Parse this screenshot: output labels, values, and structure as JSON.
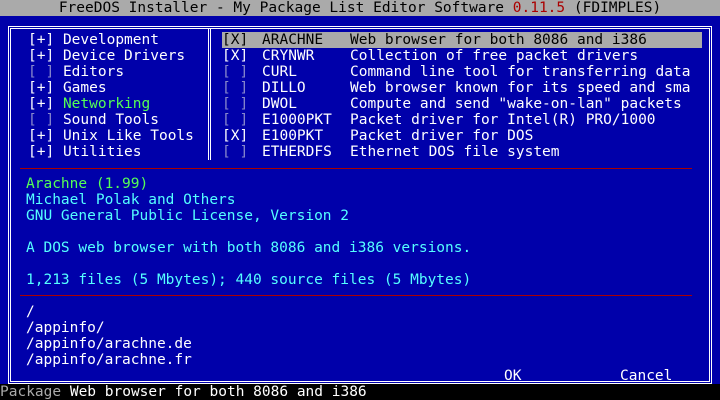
{
  "title": {
    "prefix": "FreeDOS Installer - My Package List Editor Software ",
    "version": "0.11.5",
    "suffix": " (FDIMPLES)"
  },
  "categories": [
    {
      "check": "[+]",
      "label": "Development"
    },
    {
      "check": "[+]",
      "label": "Device Drivers"
    },
    {
      "check": "[ ]",
      "label": "Editors"
    },
    {
      "check": "[+]",
      "label": "Games"
    },
    {
      "check": "[+]",
      "label": "Networking"
    },
    {
      "check": "[ ]",
      "label": "Sound Tools"
    },
    {
      "check": "[+]",
      "label": "Unix Like Tools"
    },
    {
      "check": "[+]",
      "label": "Utilities"
    }
  ],
  "selected_category": "Networking",
  "packages": [
    {
      "check": "[X]",
      "name": "ARACHNE",
      "desc": "Web browser for both 8086 and i386"
    },
    {
      "check": "[X]",
      "name": "CRYNWR",
      "desc": "Collection of free packet drivers"
    },
    {
      "check": "[ ]",
      "name": "CURL",
      "desc": "Command line tool for transferring data"
    },
    {
      "check": "[ ]",
      "name": "DILLO",
      "desc": "Web browser known for its speed and sma"
    },
    {
      "check": "[ ]",
      "name": "DWOL",
      "desc": "Compute and send \"wake-on-lan\" packets"
    },
    {
      "check": "[ ]",
      "name": "E1000PKT",
      "desc": "Packet driver for Intel(R) PRO/1000"
    },
    {
      "check": "[X]",
      "name": "E100PKT",
      "desc": "Packet driver for DOS"
    },
    {
      "check": "[ ]",
      "name": "ETHERDFS",
      "desc": "Ethernet DOS file system"
    }
  ],
  "selected_package": "ARACHNE",
  "info": {
    "title": "Arachne (1.99)",
    "author": "Michael Polak and Others",
    "license": "GNU General Public License, Version 2",
    "description": "A DOS web browser with both 8086 and i386 versions.",
    "files": "1,213 files (5 Mbytes); 440 source files (5 Mbytes)"
  },
  "file_list": [
    "/",
    "/appinfo/",
    "/appinfo/arachne.de",
    "/appinfo/arachne.fr"
  ],
  "buttons": {
    "ok": "OK",
    "cancel": "Cancel"
  },
  "status": {
    "label": "Package",
    "value": "Web browser for both 8086 and i386"
  },
  "colors": {
    "background": "#0000aa",
    "title_bar": "#aaaaaa",
    "version_text": "#aa0000",
    "highlight": "#55ff55",
    "info_text": "#55ffff"
  }
}
